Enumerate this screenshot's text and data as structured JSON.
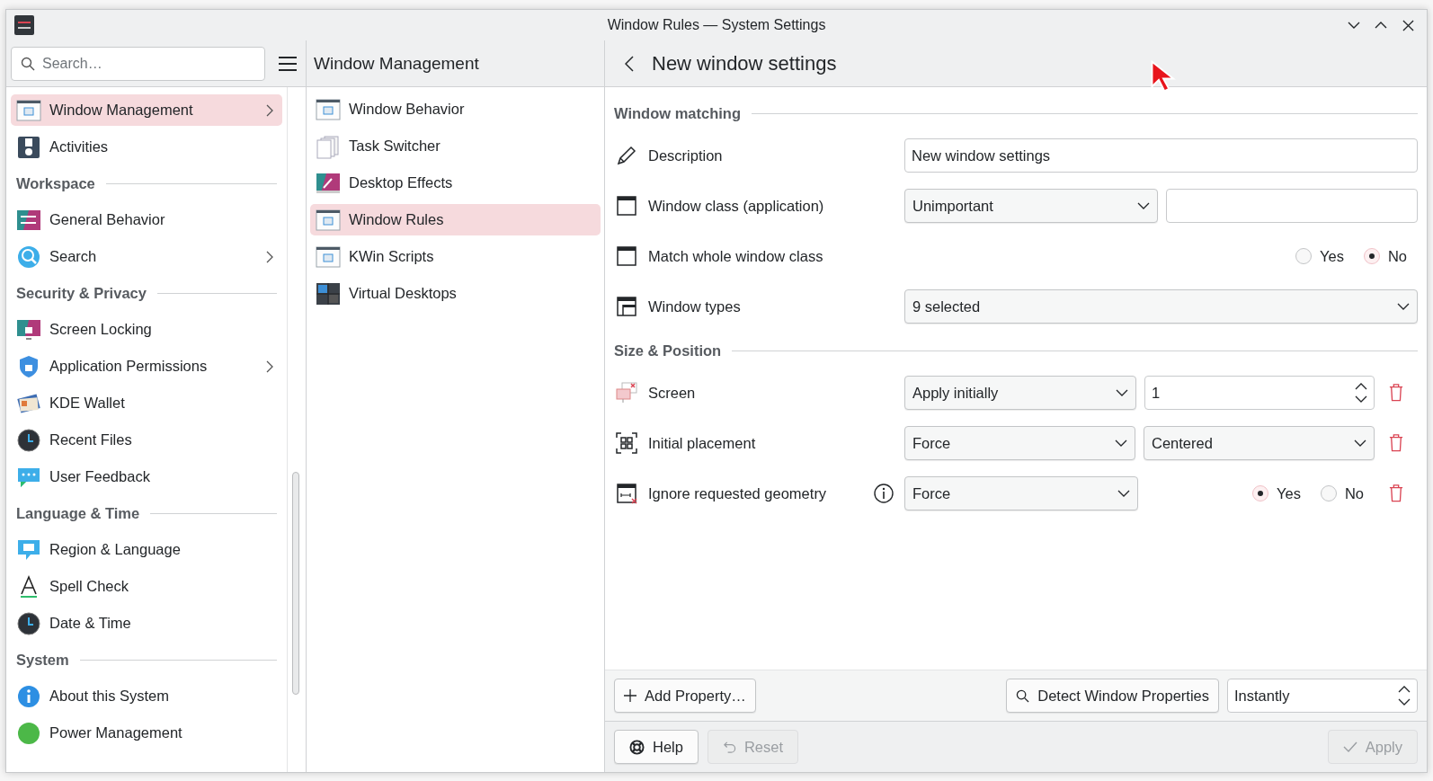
{
  "window": {
    "title": "Window Rules — System Settings"
  },
  "search": {
    "placeholder": "Search…"
  },
  "sidebar": {
    "items": [
      {
        "kind": "item",
        "label": "Window Management",
        "selected": true,
        "has_children": true
      },
      {
        "kind": "item",
        "label": "Activities",
        "selected": false,
        "has_children": false
      },
      {
        "kind": "header",
        "label": "Workspace"
      },
      {
        "kind": "item",
        "label": "General Behavior",
        "selected": false,
        "has_children": false
      },
      {
        "kind": "item",
        "label": "Search",
        "selected": false,
        "has_children": true
      },
      {
        "kind": "header",
        "label": "Security & Privacy"
      },
      {
        "kind": "item",
        "label": "Screen Locking",
        "selected": false,
        "has_children": false
      },
      {
        "kind": "item",
        "label": "Application Permissions",
        "selected": false,
        "has_children": true
      },
      {
        "kind": "item",
        "label": "KDE Wallet",
        "selected": false,
        "has_children": false
      },
      {
        "kind": "item",
        "label": "Recent Files",
        "selected": false,
        "has_children": false
      },
      {
        "kind": "item",
        "label": "User Feedback",
        "selected": false,
        "has_children": false
      },
      {
        "kind": "header",
        "label": "Language & Time"
      },
      {
        "kind": "item",
        "label": "Region & Language",
        "selected": false,
        "has_children": false
      },
      {
        "kind": "item",
        "label": "Spell Check",
        "selected": false,
        "has_children": false
      },
      {
        "kind": "item",
        "label": "Date & Time",
        "selected": false,
        "has_children": false
      },
      {
        "kind": "header",
        "label": "System"
      },
      {
        "kind": "item",
        "label": "About this System",
        "selected": false,
        "has_children": false
      },
      {
        "kind": "item",
        "label": "Power Management",
        "selected": false,
        "has_children": false
      }
    ]
  },
  "modules": {
    "title": "Window Management",
    "items": [
      {
        "label": "Window Behavior",
        "selected": false
      },
      {
        "label": "Task Switcher",
        "selected": false
      },
      {
        "label": "Desktop Effects",
        "selected": false
      },
      {
        "label": "Window Rules",
        "selected": true
      },
      {
        "label": "KWin Scripts",
        "selected": false
      },
      {
        "label": "Virtual Desktops",
        "selected": false
      }
    ]
  },
  "page": {
    "title": "New window settings",
    "sections": [
      {
        "title": "Window matching",
        "rows": [
          {
            "label": "Description",
            "info": false,
            "removable": false,
            "controls": [
              {
                "kind": "text",
                "value": "New window settings"
              }
            ]
          },
          {
            "label": "Window class (application)",
            "info": false,
            "removable": false,
            "controls": [
              {
                "kind": "dropdown",
                "value": "Unimportant"
              },
              {
                "kind": "text"
              }
            ]
          },
          {
            "label": "Match whole window class",
            "info": false,
            "removable": false,
            "controls": [
              {
                "kind": "radio",
                "options": [
                  {
                    "label": "Yes",
                    "selected": false
                  },
                  {
                    "label": "No",
                    "selected": true
                  }
                ]
              }
            ]
          },
          {
            "label": "Window types",
            "info": false,
            "removable": false,
            "controls": [
              {
                "kind": "dropdown",
                "value": "9 selected"
              }
            ]
          }
        ]
      },
      {
        "title": "Size & Position",
        "rows": [
          {
            "label": "Screen",
            "info": false,
            "removable": true,
            "controls": [
              {
                "kind": "dropdown",
                "value": "Apply initially"
              },
              {
                "kind": "spin",
                "value": "1"
              }
            ]
          },
          {
            "label": "Initial placement",
            "info": false,
            "removable": true,
            "controls": [
              {
                "kind": "dropdown",
                "value": "Force"
              },
              {
                "kind": "dropdown",
                "value": "Centered"
              }
            ]
          },
          {
            "label": "Ignore requested geometry",
            "info": true,
            "removable": true,
            "controls": [
              {
                "kind": "dropdown",
                "value": "Force"
              },
              {
                "kind": "radio",
                "options": [
                  {
                    "label": "Yes",
                    "selected": true
                  },
                  {
                    "label": "No",
                    "selected": false
                  }
                ]
              }
            ]
          }
        ]
      }
    ]
  },
  "footer": {
    "add": "Add Property…",
    "detect": "Detect Window Properties",
    "delay": "Instantly"
  },
  "buttons": [
    {
      "kind": "help",
      "label": "Help",
      "disabled": false
    },
    {
      "kind": "reset",
      "label": "Reset",
      "disabled": true
    },
    {
      "kind": "apply",
      "label": "Apply",
      "disabled": true
    }
  ]
}
